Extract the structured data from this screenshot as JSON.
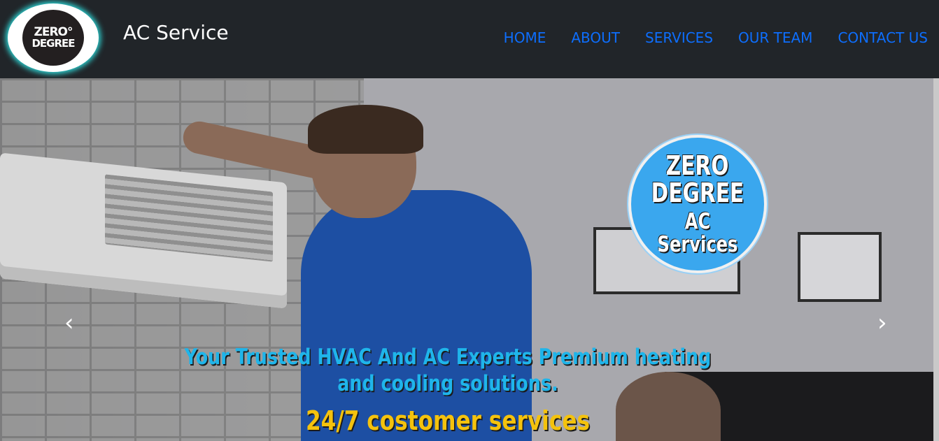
{
  "header": {
    "logo": {
      "line1": "ZERO°",
      "line2": "DEGREE"
    },
    "brand": "AC Service",
    "nav": [
      "HOME",
      "ABOUT",
      "SERVICES",
      "OUR TEAM",
      "CONTACT US"
    ]
  },
  "hero": {
    "badge": {
      "line1": "ZERO",
      "line2": "DEGREE",
      "line3": "AC Services"
    },
    "caption": "Your Trusted HVAC And AC Experts Premium heating and cooling solutions.",
    "sub_caption": "24/7 costomer services",
    "prev_icon": "chevron-left-icon",
    "next_icon": "chevron-right-icon"
  },
  "colors": {
    "nav_link": "#0d6efd",
    "navbar_bg": "#212529",
    "caption": "#1fb5ea",
    "sub_caption": "#f4c20d",
    "badge": "#3aa7ee"
  }
}
